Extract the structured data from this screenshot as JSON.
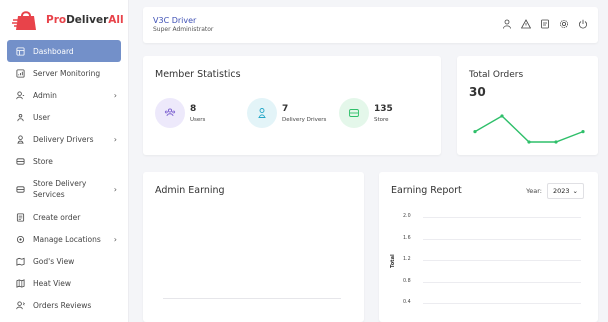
{
  "brand": {
    "name_red": "Pro",
    "name_dark": "Deliver",
    "name_tail": "All"
  },
  "sidebar": {
    "items": [
      {
        "label": "Dashboard",
        "icon": "dashboard-icon",
        "active": true
      },
      {
        "label": "Server Monitoring",
        "icon": "monitor-icon"
      },
      {
        "label": "Admin",
        "icon": "admin-icon",
        "chevron": "›"
      },
      {
        "label": "User",
        "icon": "users-icon"
      },
      {
        "label": "Delivery Drivers",
        "icon": "driver-icon",
        "chevron": "›"
      },
      {
        "label": "Store",
        "icon": "store-icon"
      },
      {
        "label": "Store Delivery Services",
        "icon": "store-delivery-icon",
        "chevron": "›"
      },
      {
        "label": "Create order",
        "icon": "order-icon"
      },
      {
        "label": "Manage Locations",
        "icon": "location-icon",
        "chevron": "›"
      },
      {
        "label": "God's View",
        "icon": "map-icon"
      },
      {
        "label": "Heat View",
        "icon": "heatmap-icon"
      },
      {
        "label": "Orders Reviews",
        "icon": "review-icon"
      }
    ]
  },
  "topbar": {
    "title": "V3C Driver",
    "subtitle": "Super Administrator"
  },
  "member_stats": {
    "title": "Member Statistics",
    "stats": [
      {
        "value": "8",
        "label": "Users",
        "color": "#ede9fb",
        "icon_color": "#7b5fd0"
      },
      {
        "value": "7",
        "label": "Delivery Drivers",
        "color": "#e3f4f8",
        "icon_color": "#25a7c7"
      },
      {
        "value": "135",
        "label": "Store",
        "color": "#e4f7ea",
        "icon_color": "#2fbf6a"
      }
    ]
  },
  "total_orders": {
    "title": "Total Orders",
    "value": "30",
    "spark_values": [
      4,
      7,
      2,
      2,
      4
    ],
    "color": "#2fbf6a"
  },
  "admin_earning": {
    "title": "Admin Earning"
  },
  "earning_report": {
    "title": "Earning Report",
    "year_label": "Year:",
    "year_value": "2023",
    "ylabel": "Total",
    "ticks": [
      "2.0",
      "1.6",
      "1.2",
      "0.8",
      "0.4"
    ]
  }
}
